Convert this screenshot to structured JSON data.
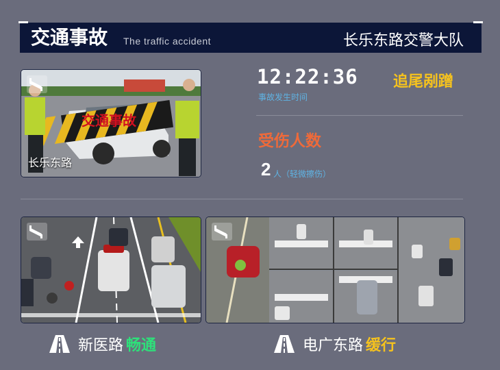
{
  "header": {
    "title_cn": "交通事故",
    "title_en": "The traffic accident",
    "unit": "长乐东路交警大队"
  },
  "main_camera": {
    "location": "长乐东路",
    "banner": "交通事故"
  },
  "accident": {
    "time": "12:22:36",
    "time_label": "事故发生时间",
    "type": "追尾剐蹭",
    "injured_title": "受伤人数",
    "injured_count": "2",
    "injured_unit": "人（轻微擦伤）"
  },
  "roads": [
    {
      "name": "新医路",
      "status": "畅通",
      "status_color": "#2ee07a"
    },
    {
      "name": "电广东路",
      "status": "缓行",
      "status_color": "#f5c21e"
    }
  ],
  "colors": {
    "background": "#6a6c7c",
    "header_bg": "#0c1638",
    "accent_yellow": "#f5c21e",
    "accent_orange": "#ee6a3a",
    "accent_blue": "#5fb3e3",
    "accent_green": "#2ee07a"
  },
  "icons": {
    "camera": "cctv-camera-icon",
    "road": "road-icon"
  }
}
